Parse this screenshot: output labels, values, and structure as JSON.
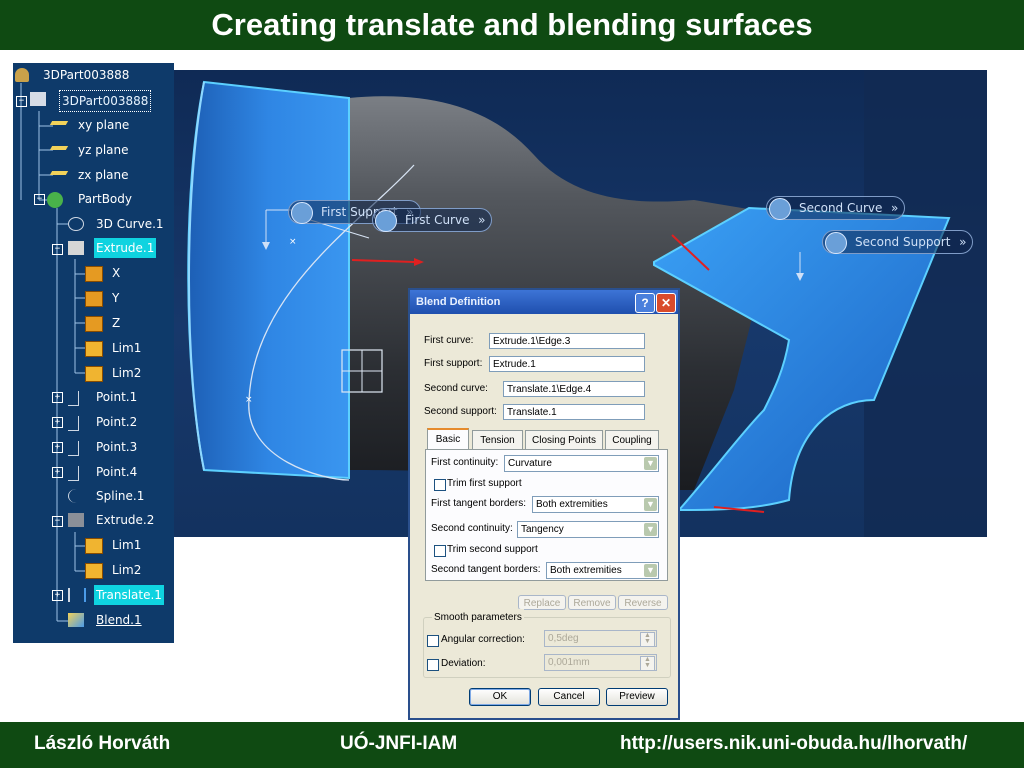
{
  "slide": {
    "title": "Creating  translate and blending surfaces",
    "footer": {
      "author": "László Horváth",
      "department": "UÓ-JNFI-IAM",
      "url": "http://users.nik.uni-obuda.hu/lhorvath/"
    }
  },
  "viewport": {
    "labels": {
      "first_support": "First Support",
      "first_curve": "First Curve",
      "second_curve": "Second Curve",
      "second_support": "Second Support"
    }
  },
  "tree": {
    "root": "3DPart003888",
    "part": "3DPart003888",
    "items": [
      {
        "label": "xy plane"
      },
      {
        "label": "yz plane"
      },
      {
        "label": "zx plane"
      },
      {
        "label": "PartBody"
      },
      {
        "label": "3D Curve.1"
      },
      {
        "label": "Extrude.1"
      },
      {
        "label": "X"
      },
      {
        "label": "Y"
      },
      {
        "label": "Z"
      },
      {
        "label": "Lim1"
      },
      {
        "label": "Lim2"
      },
      {
        "label": "Point.1"
      },
      {
        "label": "Point.2"
      },
      {
        "label": "Point.3"
      },
      {
        "label": "Point.4"
      },
      {
        "label": "Spline.1"
      },
      {
        "label": "Extrude.2"
      },
      {
        "label": "Lim1"
      },
      {
        "label": "Lim2"
      },
      {
        "label": "Translate.1"
      },
      {
        "label": "Blend.1"
      }
    ]
  },
  "dialog": {
    "title": "Blend Definition",
    "help": "?",
    "close": "✕",
    "first_curve_label": "First curve:",
    "first_curve_value": "Extrude.1\\Edge.3",
    "first_support_label": "First support:",
    "first_support_value": "Extrude.1",
    "second_curve_label": "Second curve:",
    "second_curve_value": "Translate.1\\Edge.4",
    "second_support_label": "Second support:",
    "second_support_value": "Translate.1",
    "tabs": [
      "Basic",
      "Tension",
      "Closing Points",
      "Coupling"
    ],
    "basic": {
      "first_continuity_label": "First continuity:",
      "first_continuity_value": "Curvature",
      "trim_first_support": "Trim first support",
      "first_tangent_label": "First tangent borders:",
      "first_tangent_value": "Both extremities",
      "second_continuity_label": "Second continuity:",
      "second_continuity_value": "Tangency",
      "trim_second_support": "Trim second support",
      "second_tangent_label": "Second tangent borders:",
      "second_tangent_value": "Both extremities"
    },
    "replace": "Replace",
    "remove": "Remove",
    "reverse": "Reverse",
    "smooth_title": "Smooth parameters",
    "angular_label": "Angular correction:",
    "angular_value": "0,5deg",
    "deviation_label": "Deviation:",
    "deviation_value": "0,001mm",
    "ok": "OK",
    "cancel": "Cancel",
    "preview": "Preview"
  }
}
